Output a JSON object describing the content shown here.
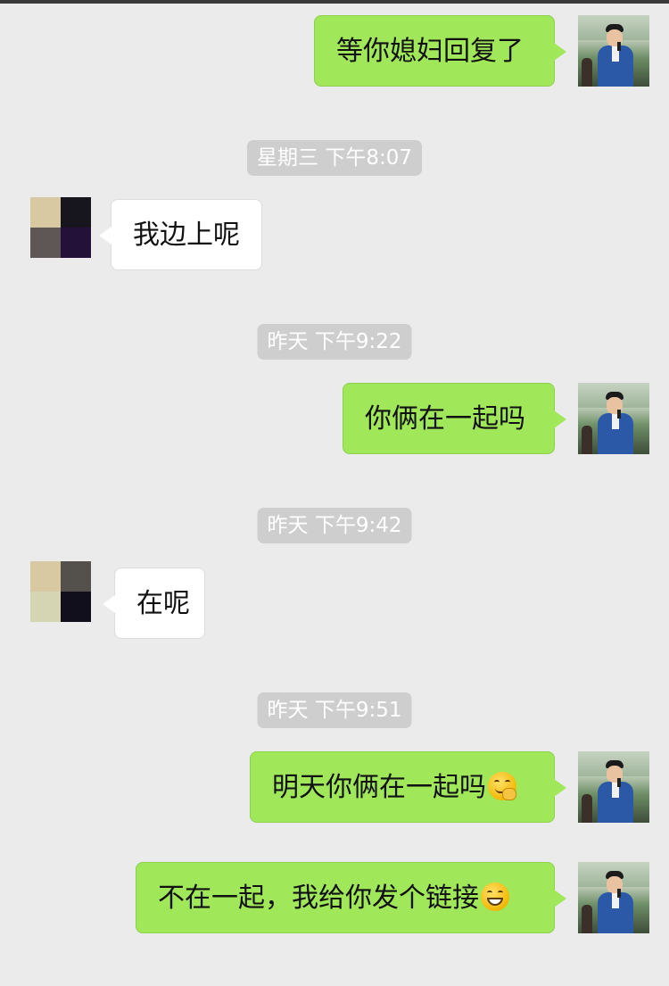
{
  "chat": {
    "messages": [
      {
        "id": 1,
        "side": "me",
        "text": "等你媳妇回复了"
      },
      {
        "id": 2,
        "timestamp": "星期三 下午8:07"
      },
      {
        "id": 3,
        "side": "other",
        "text": "我边上呢"
      },
      {
        "id": 4,
        "timestamp": "昨天 下午9:22"
      },
      {
        "id": 5,
        "side": "me",
        "text": "你俩在一起吗"
      },
      {
        "id": 6,
        "timestamp": "昨天 下午9:42"
      },
      {
        "id": 7,
        "side": "other",
        "text": "在呢"
      },
      {
        "id": 8,
        "timestamp": "昨天 下午9:51"
      },
      {
        "id": 9,
        "side": "me",
        "text": "明天你俩在一起吗",
        "emoji": "thinking-face-emoji"
      },
      {
        "id": 10,
        "side": "me",
        "text": "不在一起，我给你发个链接",
        "emoji": "grinning-face-emoji"
      }
    ]
  },
  "colors": {
    "background": "#ebebeb",
    "my_bubble": "#a0e75a",
    "other_bubble": "#ffffff",
    "timestamp_pill": "#cecece"
  },
  "icons": {
    "my_avatar": "profile-photo-man-in-blue-suit",
    "other_avatar": "pixelated-profile-photo"
  }
}
